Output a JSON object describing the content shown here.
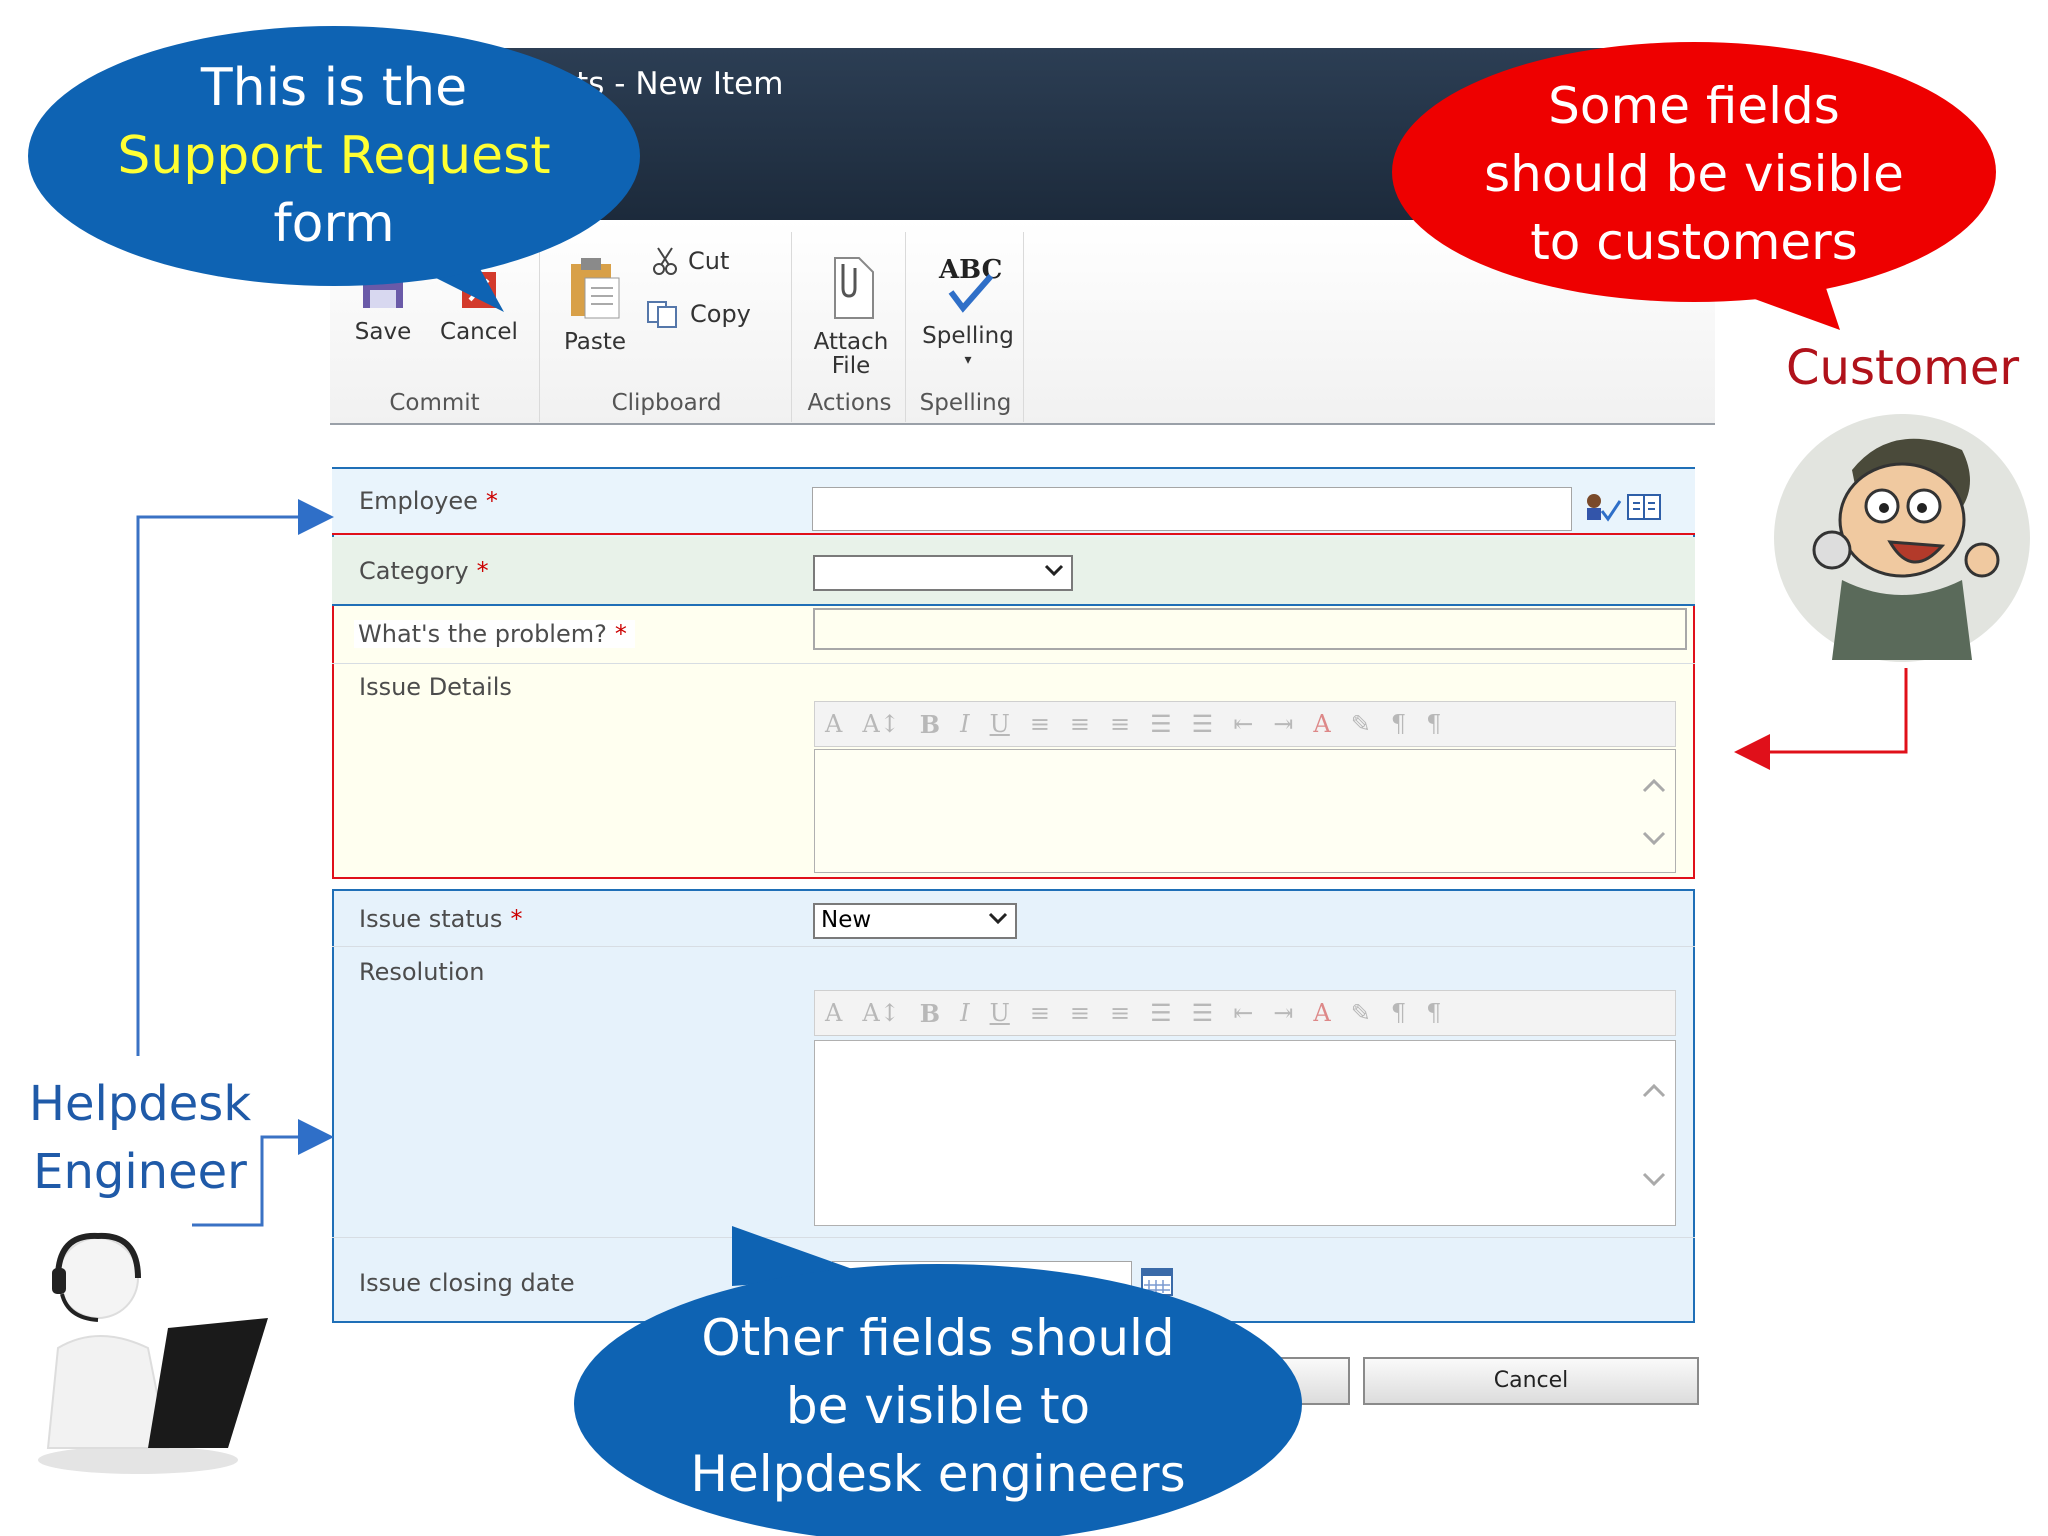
{
  "window": {
    "title": "sts - New Item"
  },
  "ribbon": {
    "groups": [
      {
        "label": "Commit",
        "buttons": [
          "Save",
          "Cancel"
        ]
      },
      {
        "label": "Clipboard",
        "buttons": [
          "Paste",
          "Cut",
          "Copy"
        ]
      },
      {
        "label": "Actions",
        "buttons": [
          "Attach File"
        ]
      },
      {
        "label": "Spelling",
        "buttons": [
          "Spelling"
        ]
      }
    ],
    "save": "Save",
    "cancel": "Cancel",
    "paste": "Paste",
    "cut": "Cut",
    "copy": "Copy",
    "attach_line1": "Attach",
    "attach_line2": "File",
    "spelling": "Spelling",
    "spelling_icon_text": "ABC",
    "commit": "Commit",
    "clipboard": "Clipboard",
    "actions": "Actions",
    "spelling_group": "Spelling"
  },
  "form": {
    "employee": {
      "label": "Employee",
      "required": "*",
      "value": ""
    },
    "category": {
      "label": "Category",
      "required": "*",
      "value": ""
    },
    "problem": {
      "label": "What's the problem?",
      "required": "*",
      "value": ""
    },
    "issue_details": {
      "label": "Issue Details"
    },
    "issue_status": {
      "label": "Issue status",
      "required": "*",
      "value": "New"
    },
    "resolution": {
      "label": "Resolution"
    },
    "closing_date": {
      "label": "Issue closing date"
    },
    "rte_toolbar": [
      "A",
      "A↕",
      "B",
      "I",
      "U",
      "≡",
      "≡",
      "≡",
      "☰",
      "☰",
      "⇤",
      "⇥",
      "A",
      "✎",
      "¶",
      "¶"
    ]
  },
  "footer": {
    "cancel": "Cancel"
  },
  "callouts": {
    "top_left": {
      "line1": "This is the",
      "line2": "Support Request",
      "line3": "form"
    },
    "top_right": {
      "line1": "Some fields",
      "line2": "should be visible",
      "line3": "to customers"
    },
    "bottom": {
      "line1": "Other fields should",
      "line2": "be visible to",
      "line3": "Helpdesk engineers"
    }
  },
  "labels": {
    "customer": "Customer",
    "helpdesk_line1": "Helpdesk",
    "helpdesk_line2": "Engineer"
  },
  "colors": {
    "blue_callout": "#0e63b3",
    "red_callout": "#ee0000",
    "highlight_yellow": "#ffff33",
    "customer_red": "#b0121b",
    "helpdesk_blue": "#1f5aa8",
    "customer_section": "#ffffee",
    "engineer_section": "#e6f2fb"
  }
}
